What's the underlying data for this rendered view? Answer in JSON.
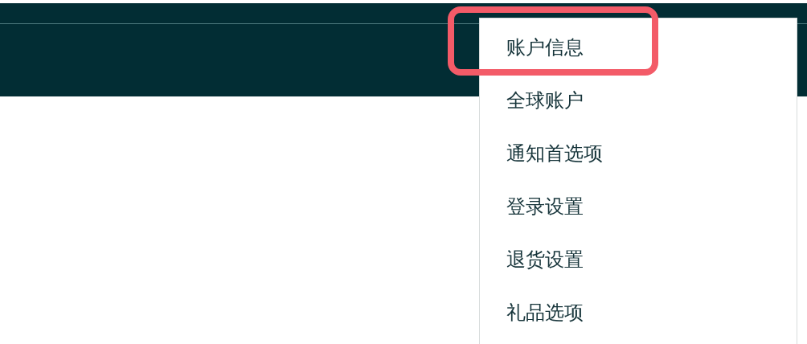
{
  "menu": {
    "items": [
      {
        "label": "账户信息",
        "highlighted": true
      },
      {
        "label": "全球账户",
        "highlighted": false
      },
      {
        "label": "通知首选项",
        "highlighted": false
      },
      {
        "label": "登录设置",
        "highlighted": false
      },
      {
        "label": "退货设置",
        "highlighted": false
      },
      {
        "label": "礼品选项",
        "highlighted": false
      }
    ]
  }
}
